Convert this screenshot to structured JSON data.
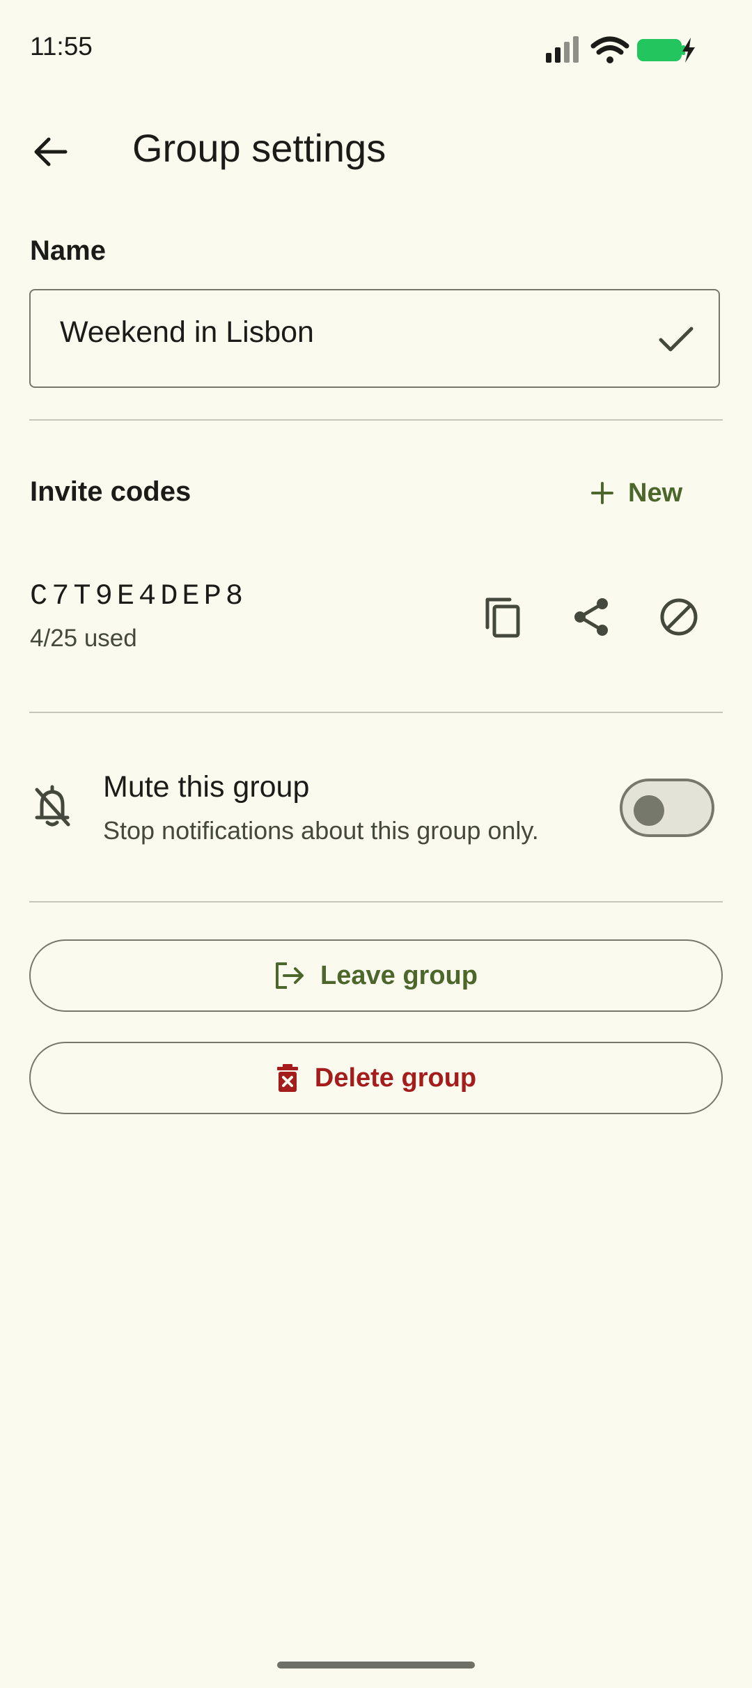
{
  "status_bar": {
    "time": "11:55"
  },
  "app_bar": {
    "title": "Group settings"
  },
  "name_section": {
    "label": "Name",
    "value": "Weekend in Lisbon"
  },
  "invite_section": {
    "label": "Invite codes",
    "new_label": "New",
    "codes": [
      {
        "code": "C7T9E4DEP8",
        "usage": "4/25 used"
      }
    ]
  },
  "mute": {
    "title": "Mute this group",
    "subtitle": "Stop notifications about this group only.",
    "enabled": false
  },
  "actions": {
    "leave_label": "Leave group",
    "delete_label": "Delete group"
  },
  "colors": {
    "background": "#FAFAEF",
    "primary": "#4C662B",
    "error": "#A51C1C",
    "battery": "#22C55E"
  }
}
